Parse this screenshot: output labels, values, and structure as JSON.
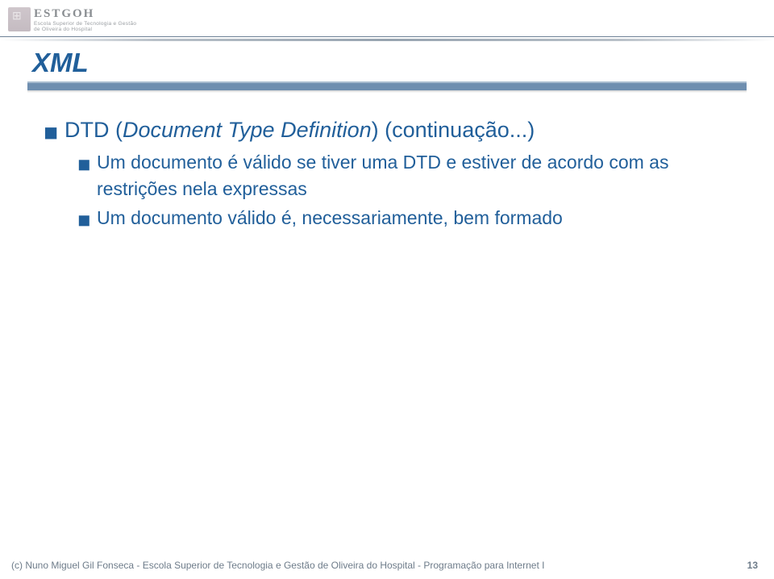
{
  "header": {
    "logo_text_line1": "ESTGOH",
    "logo_text_line2": "Escola Superior de Tecnologia e Gestão",
    "logo_text_line3": "de Oliveira do Hospital"
  },
  "slide": {
    "title": "XML",
    "bullet1_prefix": "DTD (",
    "bullet1_ital": "Document Type Definition",
    "bullet1_suffix": ") (continuação...)",
    "bullet2a": "Um documento é válido se tiver uma DTD e estiver de acordo com as restrições nela expressas",
    "bullet2b": "Um documento válido é, necessariamente, bem formado"
  },
  "footer": {
    "text": "(c) Nuno Miguel Gil Fonseca  -  Escola Superior de Tecnologia e Gestão de Oliveira do Hospital  -  Programação para Internet I",
    "page": "13"
  }
}
